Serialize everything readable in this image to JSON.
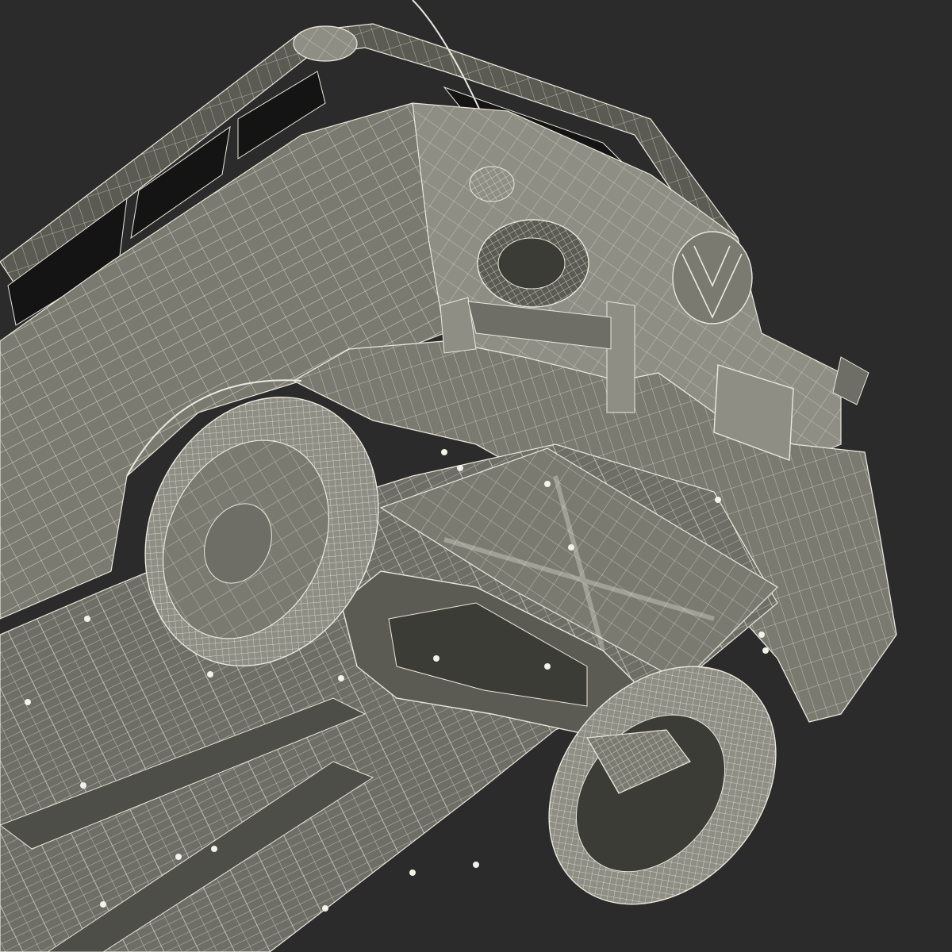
{
  "scene": {
    "subject": "vehicle-underside-wireframe",
    "background_color": "#2b2b2b",
    "surface_color": "#7a7a70",
    "surface_light_color": "#8e8e84",
    "surface_dark_color": "#5b5b53",
    "wire_color": "#e8e8dc",
    "shadow_color": "#1e1e1c"
  }
}
